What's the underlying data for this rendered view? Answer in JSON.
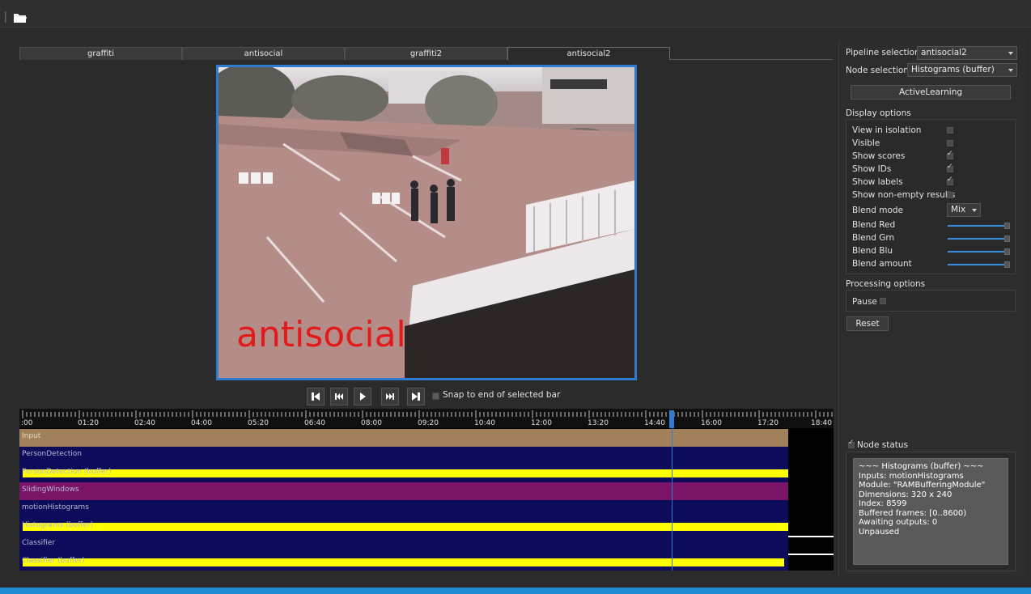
{
  "toolbar": {
    "open_icon": "folder-open-icon"
  },
  "tabs": [
    {
      "label": "graffiti",
      "active": false
    },
    {
      "label": "antisocial",
      "active": false
    },
    {
      "label": "graffiti2",
      "active": false
    },
    {
      "label": "antisocial2",
      "active": true
    }
  ],
  "video": {
    "overlay_label": "antisocial",
    "overlay_color": "#e41a1a"
  },
  "transport": {
    "buttons": [
      "skip-to-start-icon",
      "step-back-icon",
      "play-icon",
      "step-forward-icon",
      "skip-to-end-icon"
    ],
    "snap_label": "Snap to end of selected bar",
    "snap_checked": false
  },
  "timeline": {
    "tick_labels": [
      ":00",
      "01:20",
      "02:40",
      "04:00",
      "05:20",
      "06:40",
      "08:00",
      "09:20",
      "10:40",
      "12:00",
      "13:20",
      "14:40",
      "16:00",
      "17:20",
      "18:40"
    ],
    "tracks": [
      {
        "label": "Input",
        "color": "#a0815c"
      },
      {
        "label": "PersonDetection",
        "color": "#0c0c5a"
      },
      {
        "label": "PersonDetection (buffer)",
        "color": "#0c0c5a"
      },
      {
        "label": "SlidingWindows",
        "color": "#7a1466"
      },
      {
        "label": "motionHistograms",
        "color": "#0c0c5a"
      },
      {
        "label": "Histograms (buffer)",
        "color": "#0c0c5a"
      },
      {
        "label": "Classifier",
        "color": "#0c0c5a"
      },
      {
        "label": "Classifier (buffer)",
        "color": "#0c0c5a"
      }
    ]
  },
  "panel": {
    "pipeline_label": "Pipeline selection",
    "pipeline_value": "antisocial2",
    "node_label": "Node selection",
    "node_value": "Histograms (buffer)",
    "active_learning": "ActiveLearning",
    "display_options": "Display options",
    "options": [
      {
        "label": "View in isolation",
        "checked": false
      },
      {
        "label": "Visible",
        "checked": false
      },
      {
        "label": "Show scores",
        "checked": true
      },
      {
        "label": "Show IDs",
        "checked": true
      },
      {
        "label": "Show labels",
        "checked": true
      },
      {
        "label": "Show non-empty results",
        "checked": false
      }
    ],
    "blend_mode_label": "Blend mode",
    "blend_mode_value": "Mix",
    "sliders": [
      {
        "label": "Blend Red",
        "value": 1.0
      },
      {
        "label": "Blend Grn",
        "value": 1.0
      },
      {
        "label": "Blend Blu",
        "value": 1.0
      },
      {
        "label": "Blend amount",
        "value": 1.0
      }
    ],
    "processing_options": "Processing options",
    "pause_label": "Pause",
    "reset_label": "Reset",
    "node_status_label": "Node status",
    "node_status_checked": true,
    "status_lines": [
      "~~~ Histograms (buffer) ~~~",
      "Inputs: motionHistograms",
      "Module: \"RAMBufferingModule\"",
      "Dimensions: 320 x 240",
      "Index: 8599",
      "Buffered frames: [0..8600)",
      "Awaiting outputs: 0",
      "Unpaused"
    ]
  }
}
